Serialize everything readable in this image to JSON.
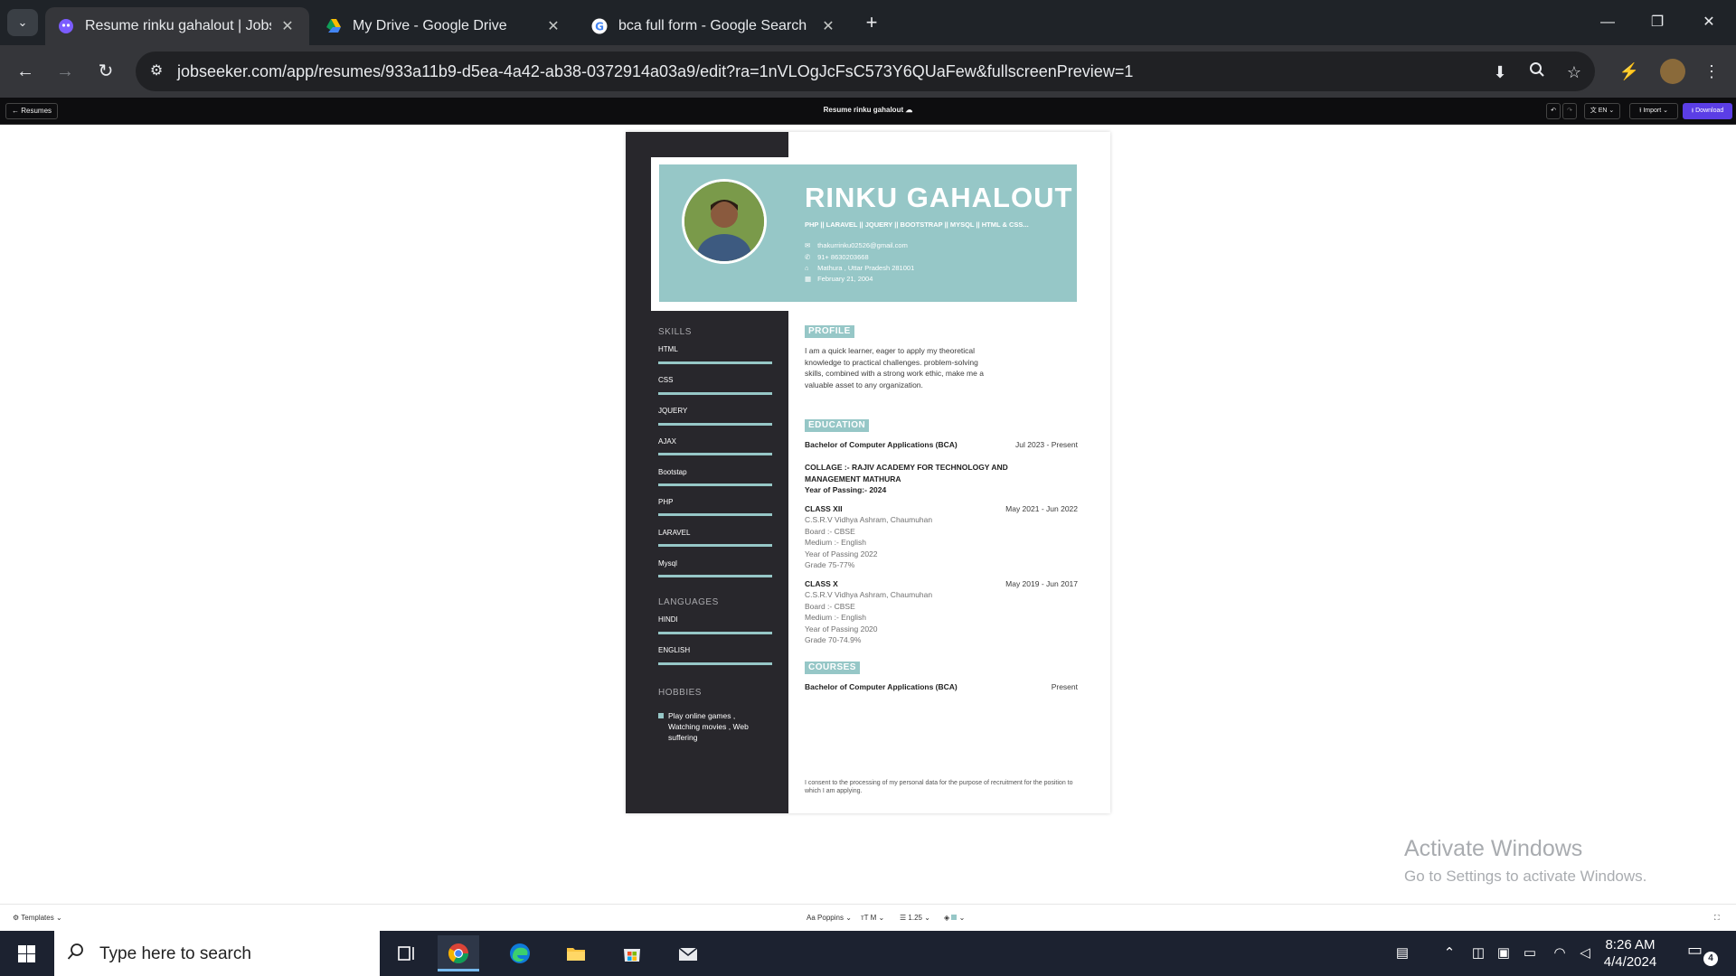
{
  "browser": {
    "tabs": [
      {
        "title": "Resume rinku gahalout | Jobseeker",
        "active": true
      },
      {
        "title": "My Drive - Google Drive",
        "active": false
      },
      {
        "title": "bca full form - Google Search",
        "active": false
      }
    ],
    "url": "jobseeker.com/app/resumes/933a11b9-d5ea-4a42-ab38-0372914a03a9/edit?ra=1nVLOgJcFsC573Y6QUaFew&fullscreenPreview=1",
    "icons": {
      "tab_search": "chevron-down-icon",
      "new_tab": "+",
      "minimize": "—",
      "restore": "❐",
      "close": "✕",
      "back": "←",
      "forward": "→",
      "reload": "↻",
      "site_info": "⚙",
      "install": "⬇",
      "zoom": "🔍",
      "bookmark": "☆",
      "extensions": "⚡",
      "menu": "⋮"
    }
  },
  "app": {
    "back_label": "← Resumes",
    "doc_title": "Resume rinku gahalout ☁",
    "undo": "↶",
    "redo": "↷",
    "language": "EN",
    "import_label": "Import",
    "download_label": "Download",
    "accent_color": "#5b3ee6"
  },
  "resume": {
    "name": "RINKU GAHALOUT",
    "tagline": "PHP || LARAVEL || JQUERY || BOOTSTRAP || MYSQL || HTML & CSS...",
    "contacts": [
      {
        "icon": "✉",
        "text": "thakurrinku02526@gmail.com"
      },
      {
        "icon": "✆",
        "text": "91+ 8630203668"
      },
      {
        "icon": "⌂",
        "text": "Mathura , Uttar Pradesh 281001"
      },
      {
        "icon": "▦",
        "text": "February 21, 2004"
      }
    ],
    "skills_heading": "SKILLS",
    "skills": [
      "HTML",
      "CSS",
      "JQUERY",
      "AJAX",
      "Bootstap",
      "PHP",
      "LARAVEL",
      "Mysql"
    ],
    "languages_heading": "LANGUAGES",
    "languages": [
      "HINDI",
      "ENGLISH"
    ],
    "hobbies_heading": "HOBBIES",
    "hobbies": "Play online games , Watching movies , Web suffering",
    "profile_heading": "PROFILE",
    "profile_text": "I am a quick learner, eager to apply my theoretical knowledge to practical challenges. problem-solving skills, combined with a strong work ethic, make me a valuable asset to any organization.",
    "education_heading": "EDUCATION",
    "education": [
      {
        "title": "Bachelor of Computer Applications (BCA)",
        "dates": "Jul 2023 - Present",
        "lines_bold": [
          "COLLAGE :-  RAJIV ACADEMY FOR TECHNOLOGY AND MANAGEMENT MATHURA",
          "Year of Passing:- 2024"
        ],
        "lines": []
      },
      {
        "title": "CLASS XII",
        "dates": "May 2021 - Jun 2022",
        "lines": [
          "C.S.R.V Vidhya Ashram, Chaumuhan",
          "Board :- CBSE",
          "Medium :- English",
          "Year of Passing 2022",
          "Grade 75-77%"
        ]
      },
      {
        "title": "CLASS X",
        "dates": "May 2019 - Jun 2017",
        "lines": [
          "C.S.R.V Vidhya Ashram, Chaumuhan",
          "Board :- CBSE",
          "Medium :- English",
          "Year of Passing 2020",
          "Grade 70-74.9%"
        ]
      }
    ],
    "courses_heading": "COURSES",
    "courses": [
      {
        "title": "Bachelor of Computer Applications (BCA)",
        "dates": "Present"
      }
    ],
    "consent": "I consent to the processing of my personal data for the purpose of recruitment for the position to which I am applying.",
    "accent_color": "#96c7c7",
    "sidebar_color": "#28272c"
  },
  "watermark": {
    "line1": "Activate Windows",
    "line2": "Go to Settings to activate Windows."
  },
  "bottombar": {
    "templates_label": "Templates",
    "font_label": "Poppins",
    "size_label": "M",
    "spacing_label": "1.25",
    "color_label": "",
    "expand": "⛶"
  },
  "taskbar": {
    "search_placeholder": "Type here to search",
    "time": "8:26 AM",
    "date": "4/4/2024",
    "notification_count": "4"
  }
}
